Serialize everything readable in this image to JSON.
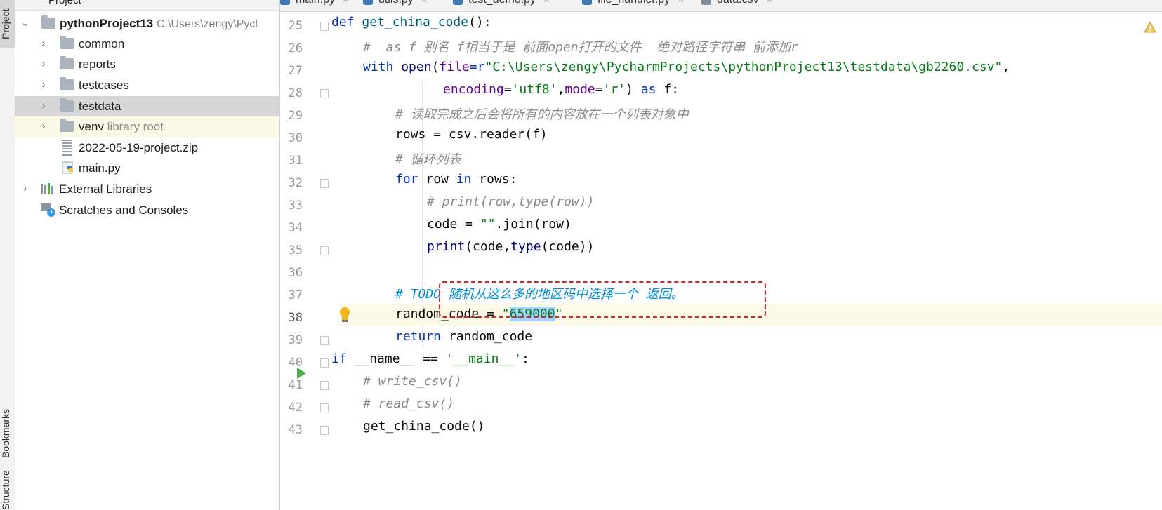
{
  "toolstrip": {
    "project_label": "Project",
    "bookmarks_label": "Bookmarks",
    "structure_label": "Structure"
  },
  "project_panel": {
    "header_title": "Project",
    "tree": [
      {
        "label": "pythonProject13",
        "path": "C:\\Users\\zengy\\Pycl",
        "type": "project-root",
        "icon": "folder-icon"
      },
      {
        "label": "common",
        "type": "folder",
        "icon": "folder-icon"
      },
      {
        "label": "reports",
        "type": "folder",
        "icon": "folder-icon"
      },
      {
        "label": "testcases",
        "type": "folder",
        "icon": "folder-icon"
      },
      {
        "label": "testdata",
        "type": "folder",
        "icon": "folder-icon"
      },
      {
        "label": "venv",
        "suffix": "library root",
        "type": "folder",
        "icon": "folder-icon"
      },
      {
        "label": "2022-05-19-project.zip",
        "type": "file",
        "icon": "zip-file-icon"
      },
      {
        "label": "main.py",
        "type": "file",
        "icon": "python-file-icon"
      },
      {
        "label": "External Libraries",
        "type": "group",
        "icon": "libraries-icon"
      },
      {
        "label": "Scratches and Consoles",
        "type": "group",
        "icon": "scratches-icon"
      }
    ]
  },
  "tabs": [
    {
      "label": "main.py",
      "icon": "python-file-icon"
    },
    {
      "label": "utils.py",
      "icon": "python-file-icon"
    },
    {
      "label": "test_demo.py",
      "icon": "python-file-icon"
    },
    {
      "label": "file_handler.py",
      "icon": "python-file-icon",
      "active": true
    },
    {
      "label": "data.csv",
      "icon": "csv-file-icon"
    }
  ],
  "editor": {
    "line_numbers": [
      "25",
      "26",
      "27",
      "28",
      "29",
      "30",
      "31",
      "32",
      "33",
      "34",
      "35",
      "36",
      "37",
      "38",
      "39",
      "40",
      "41",
      "42",
      "43"
    ],
    "code": {
      "l25_def": "def",
      "l25_name": "get_china_code",
      "l25_rest": "():",
      "l26": "#  as f 别名 f相当于是 前面open打开的文件  绝对路径字符串 前添加r",
      "l27_with": "with",
      "l27_open": "open",
      "l27_paren": "(",
      "l27_file": "file",
      "l27_eq": "=r",
      "l27_str": "\"C:\\Users\\zengy\\PycharmProjects\\pythonProject13\\testdata\\gb2260.csv\"",
      "l27_comma": ",",
      "l28_enc": "encoding",
      "l28_eq1": "=",
      "l28_s1": "'utf8'",
      "l28_comma": ",",
      "l28_mode": "mode",
      "l28_eq2": "=",
      "l28_s2": "'r'",
      "l28_close": ") ",
      "l28_as": "as",
      "l28_f": " f:",
      "l29": "# 读取完成之后会将所有的内容放在一个列表对象中",
      "l30": "rows = csv.reader(f)",
      "l31": "# 循环列表",
      "l32_for": "for",
      "l32_mid": " row ",
      "l32_in": "in",
      "l32_rest": " rows:",
      "l33": "# print(row,type(row))",
      "l34_a": "code = ",
      "l34_s": "\"\"",
      "l34_b": ".join(row)",
      "l35_print": "print",
      "l35_a": "(code,",
      "l35_type": "type",
      "l35_b": "(code))",
      "l37": "# TODO 随机从这么多的地区码中选择一个 返回。",
      "l38_a": "random_code = ",
      "l38_q1": "\"",
      "l38_sel": "659000",
      "l38_q2": "\"",
      "l39_ret": "return",
      "l39_rest": " random_code",
      "l40_if": "if",
      "l40_mid": " __name__ == ",
      "l40_s": "'__main__'",
      "l40_colon": ":",
      "l41": "# write_csv()",
      "l42": "# read_csv()",
      "l43": "get_china_code()"
    }
  },
  "colors": {
    "keyword": "#0033b3",
    "string": "#067d17",
    "comment": "#8c8c8c",
    "todo": "#008dde",
    "selection": "#a6d2ff",
    "annotation_box": "#e0202a"
  }
}
